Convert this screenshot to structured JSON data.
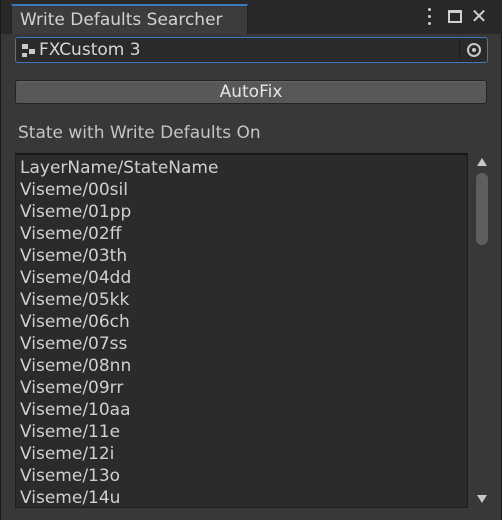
{
  "window": {
    "tab_title": "Write Defaults Searcher",
    "icons": [
      "kebab-menu-icon",
      "maximize-icon",
      "close-icon"
    ]
  },
  "object_field": {
    "value": "FXCustom 3",
    "icon": "animator-controller-icon",
    "picker_icon": "object-picker-icon"
  },
  "autofix_button": {
    "label": "AutoFix"
  },
  "section_label": "State with Write Defaults On",
  "list": {
    "items": [
      "LayerName/StateName",
      "Viseme/00sil",
      "Viseme/01pp",
      "Viseme/02ff",
      "Viseme/03th",
      "Viseme/04dd",
      "Viseme/05kk",
      "Viseme/06ch",
      "Viseme/07ss",
      "Viseme/08nn",
      "Viseme/09rr",
      "Viseme/10aa",
      "Viseme/11e",
      "Viseme/12i",
      "Viseme/13o",
      "Viseme/14u"
    ]
  },
  "colors": {
    "background": "#383838",
    "tab_accent": "#3a79bb",
    "list_background": "#2b2b2b",
    "button": "#585858"
  }
}
